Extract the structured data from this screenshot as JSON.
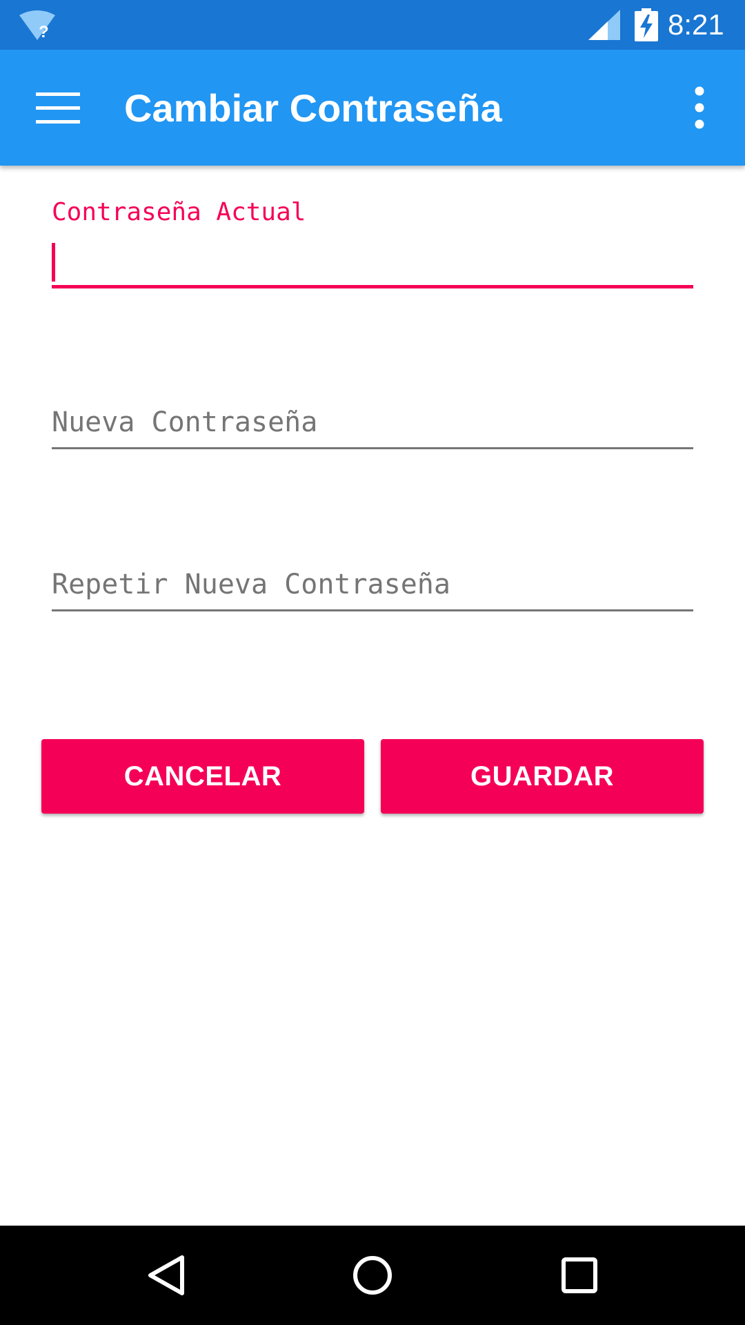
{
  "status_bar": {
    "time": "8:21",
    "wifi_icon": "wifi-unknown-icon",
    "signal_icon": "cell-signal-icon",
    "battery_icon": "battery-charging-icon"
  },
  "toolbar": {
    "title": "Cambiar Contraseña",
    "menu_icon": "hamburger-menu-icon",
    "overflow_icon": "more-vertical-icon"
  },
  "form": {
    "current_password": {
      "label": "Contraseña Actual",
      "value": "",
      "focused": true
    },
    "new_password": {
      "placeholder": "Nueva Contraseña",
      "value": ""
    },
    "repeat_password": {
      "placeholder": "Repetir Nueva Contraseña",
      "value": ""
    }
  },
  "buttons": {
    "cancel_label": "CANCELAR",
    "save_label": "GUARDAR"
  },
  "nav_bar": {
    "back_icon": "back-triangle-icon",
    "home_icon": "home-circle-icon",
    "recents_icon": "recents-square-icon"
  },
  "colors": {
    "status_bar": "#1976D2",
    "toolbar": "#2196F3",
    "accent": "#F50057",
    "hint_text": "#757575",
    "nav_bar": "#000000"
  }
}
